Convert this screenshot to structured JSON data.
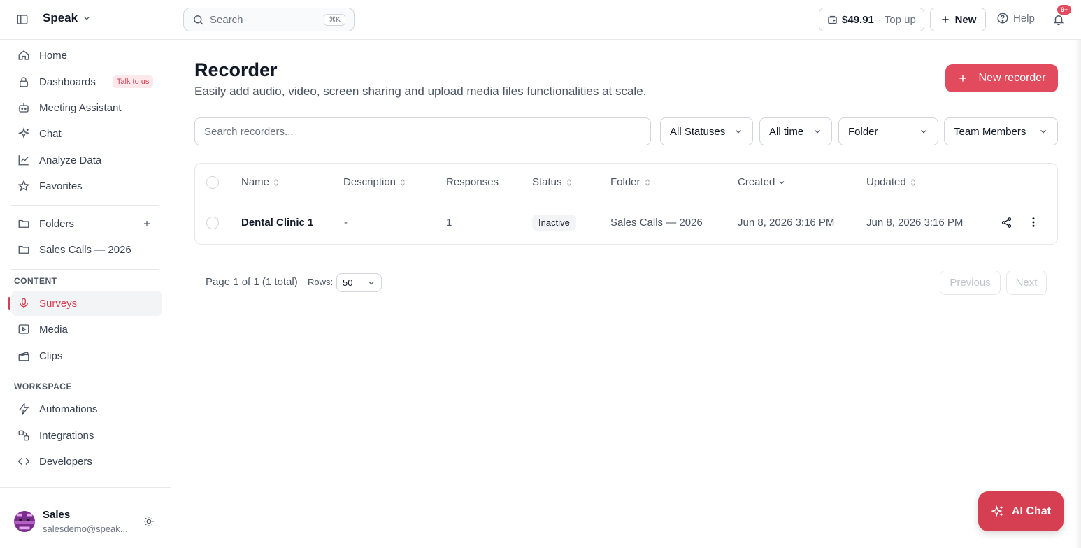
{
  "topbar": {
    "brand": "Speak",
    "search_placeholder": "Search",
    "search_shortcut": "⌘K",
    "balance_amount": "$49.91",
    "balance_action": "· Top up",
    "new_label": "New",
    "help_label": "Help",
    "notifications_badge": "9+"
  },
  "sidebar": {
    "nav": [
      {
        "label": "Home",
        "icon": "home-icon"
      },
      {
        "label": "Dashboards",
        "icon": "lock-icon",
        "badge": "Talk to us"
      },
      {
        "label": "Meeting Assistant",
        "icon": "robot-icon"
      },
      {
        "label": "Chat",
        "icon": "sparkle-icon"
      },
      {
        "label": "Analyze Data",
        "icon": "chart-line-icon"
      },
      {
        "label": "Favorites",
        "icon": "star-icon"
      }
    ],
    "folders_label": "Folders",
    "folders": [
      {
        "label": "Sales Calls — 2026",
        "icon": "folder-icon"
      }
    ],
    "content_section": "CONTENT",
    "content": [
      {
        "label": "Surveys",
        "icon": "mic-icon",
        "active": true
      },
      {
        "label": "Media",
        "icon": "media-icon"
      },
      {
        "label": "Clips",
        "icon": "clapper-icon"
      }
    ],
    "workspace_section": "WORKSPACE",
    "workspace": [
      {
        "label": "Automations",
        "icon": "bolt-icon"
      },
      {
        "label": "Integrations",
        "icon": "integrations-icon"
      },
      {
        "label": "Developers",
        "icon": "code-icon"
      }
    ],
    "user": {
      "name": "Sales",
      "email": "salesdemo@speak..."
    }
  },
  "main": {
    "title": "Recorder",
    "subtitle": "Easily add audio, video, screen sharing and upload media files functionalities at scale.",
    "new_recorder_label": "New recorder",
    "search_placeholder": "Search recorders...",
    "filters": {
      "status": "All Statuses",
      "time": "All time",
      "folder": "Folder",
      "members": "Team Members"
    },
    "table": {
      "columns": [
        "Name",
        "Description",
        "Responses",
        "Status",
        "Folder",
        "Created",
        "Updated"
      ],
      "rows": [
        {
          "name": "Dental Clinic 1",
          "description": "-",
          "responses": "1",
          "status": "Inactive",
          "folder": "Sales Calls — 2026",
          "created": "Jun 8, 2026 3:16 PM",
          "updated": "Jun 8, 2026 3:16 PM"
        }
      ]
    },
    "pagination": {
      "info": "Page 1 of 1 (1 total)",
      "rows_label": "Rows:",
      "rows_value": "50",
      "previous": "Previous",
      "next": "Next"
    }
  },
  "ai_chat_label": "AI Chat",
  "colors": {
    "accent": "#e24a5d",
    "accent_dark": "#d63f52"
  }
}
